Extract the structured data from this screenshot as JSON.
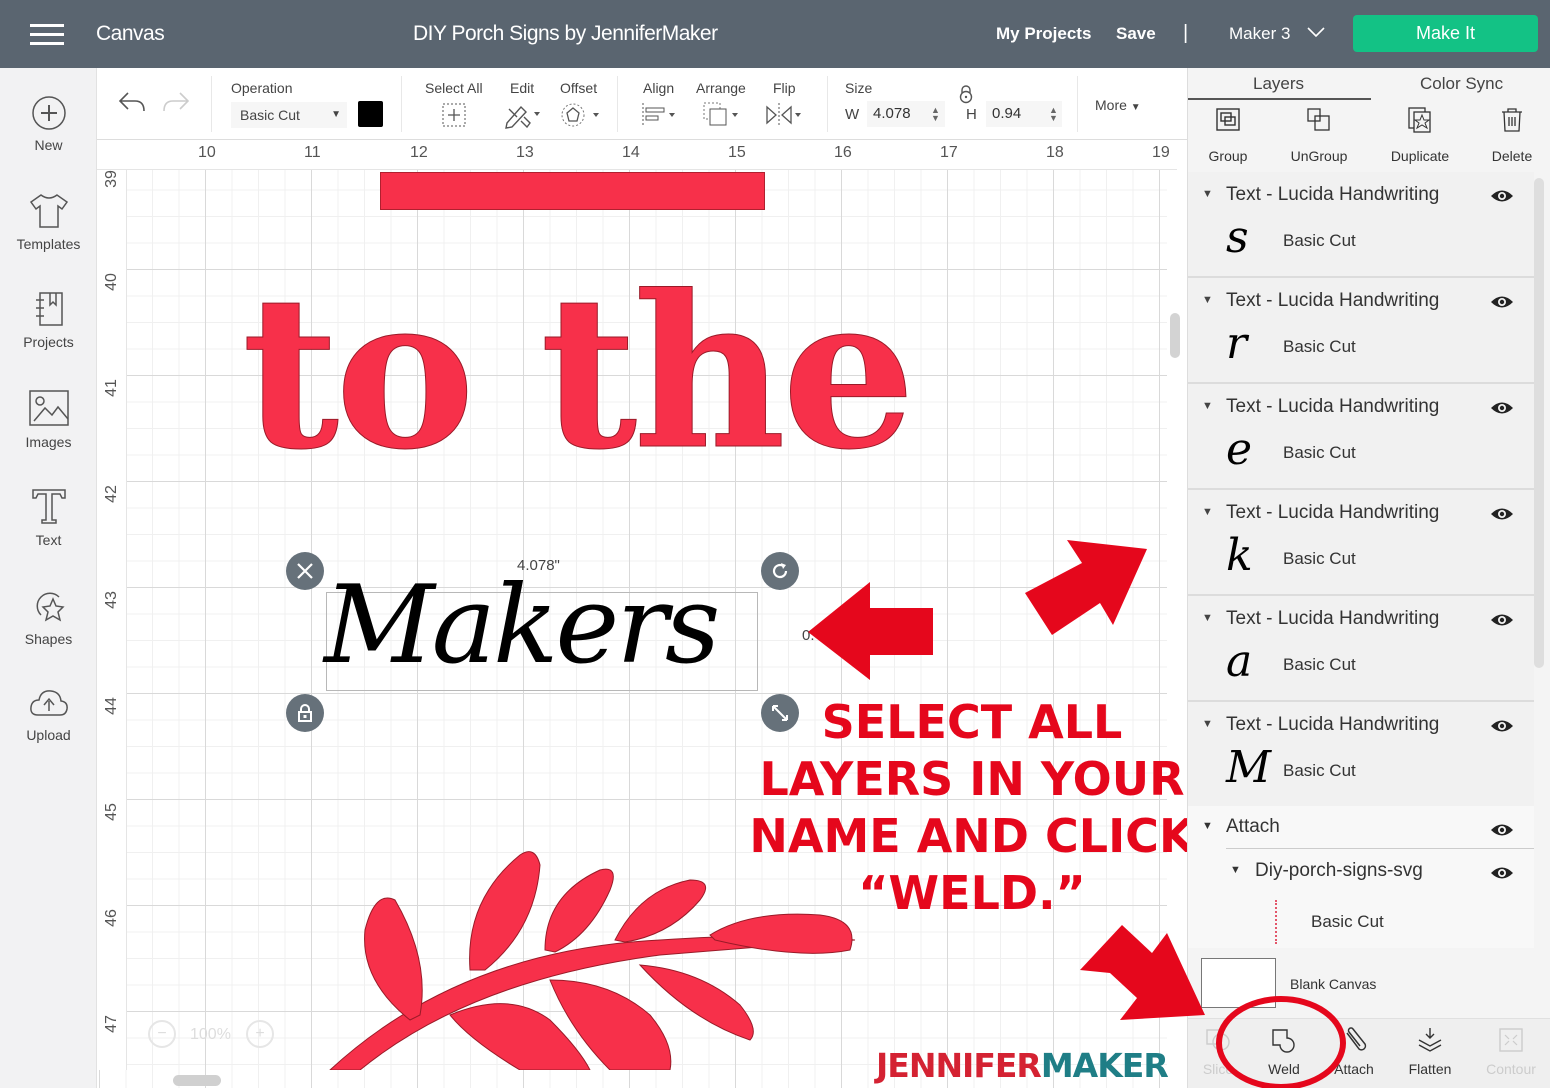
{
  "topbar": {
    "app_name": "Canvas",
    "project_title": "DIY Porch Signs by JenniferMaker",
    "my_projects": "My Projects",
    "save": "Save",
    "separator": "|",
    "machine": "Maker 3",
    "make_it": "Make It"
  },
  "sidebar": {
    "items": [
      {
        "label": "New",
        "icon": "plus-circle-icon"
      },
      {
        "label": "Templates",
        "icon": "tshirt-icon"
      },
      {
        "label": "Projects",
        "icon": "notebook-icon"
      },
      {
        "label": "Images",
        "icon": "image-icon"
      },
      {
        "label": "Text",
        "icon": "text-icon"
      },
      {
        "label": "Shapes",
        "icon": "shapes-icon"
      },
      {
        "label": "Upload",
        "icon": "cloud-upload-icon"
      }
    ]
  },
  "toolbar": {
    "operation_label": "Operation",
    "operation_value": "Basic Cut",
    "operation_color": "#000000",
    "select_all": "Select All",
    "edit": "Edit",
    "offset": "Offset",
    "align": "Align",
    "arrange": "Arrange",
    "flip": "Flip",
    "size_label": "Size",
    "w_label": "W",
    "w_value": "4.078",
    "h_label": "H",
    "h_value": "0.94",
    "more": "More"
  },
  "canvas": {
    "ruler_x": [
      "10",
      "11",
      "12",
      "13",
      "14",
      "15",
      "16",
      "17",
      "18",
      "19"
    ],
    "ruler_y": [
      "39",
      "40",
      "41",
      "42",
      "43",
      "44",
      "45",
      "46",
      "47"
    ],
    "sign_text": "to the",
    "selected_text": "Makers",
    "width_readout": "4.078\"",
    "height_readout": "0.",
    "zoom_level": "100%",
    "zoom_minus": "−",
    "zoom_plus": "+",
    "accent_red": "#f7304a"
  },
  "annotation": {
    "lines": [
      "SELECT ALL",
      "LAYERS IN YOUR",
      "NAME AND CLICK",
      "“WELD.”"
    ],
    "color": "#e5071c",
    "logo_part1": "JENNIFER",
    "logo_part2": "MAKER"
  },
  "panel": {
    "tabs": [
      "Layers",
      "Color Sync"
    ],
    "actions": [
      "Group",
      "UnGroup",
      "Duplicate",
      "Delete"
    ],
    "layers": [
      {
        "name": "Text - Lucida Handwriting",
        "glyph": "s",
        "operation": "Basic Cut"
      },
      {
        "name": "Text - Lucida Handwriting",
        "glyph": "r",
        "operation": "Basic Cut"
      },
      {
        "name": "Text - Lucida Handwriting",
        "glyph": "e",
        "operation": "Basic Cut"
      },
      {
        "name": "Text - Lucida Handwriting",
        "glyph": "k",
        "operation": "Basic Cut"
      },
      {
        "name": "Text - Lucida Handwriting",
        "glyph": "a",
        "operation": "Basic Cut"
      },
      {
        "name": "Text - Lucida Handwriting",
        "glyph": "M",
        "operation": "Basic Cut"
      }
    ],
    "attach_group": {
      "name": "Attach",
      "child_name": "Diy-porch-signs-svg",
      "child_operation": "Basic Cut"
    },
    "blank_canvas": "Blank Canvas",
    "bottom_actions": [
      {
        "label": "Slice",
        "enabled": false
      },
      {
        "label": "Weld",
        "enabled": true
      },
      {
        "label": "Attach",
        "enabled": true
      },
      {
        "label": "Flatten",
        "enabled": true
      },
      {
        "label": "Contour",
        "enabled": false
      }
    ]
  }
}
